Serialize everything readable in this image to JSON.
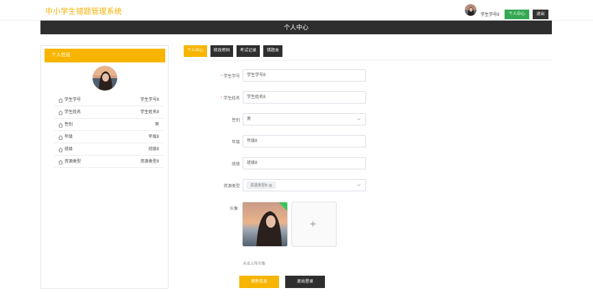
{
  "header": {
    "title": "中小学生错题管理系统",
    "user_label": "学生学号8",
    "center_button": "个人中心",
    "logout_button": "退出"
  },
  "section_title": "个人中心",
  "panel": {
    "title": "个人信息",
    "rows": [
      {
        "label": "学生学号",
        "value": "学生学号8"
      },
      {
        "label": "学生姓名",
        "value": "学生姓名8"
      },
      {
        "label": "性别",
        "value": "男"
      },
      {
        "label": "年级",
        "value": "年级8"
      },
      {
        "label": "班级",
        "value": "班级8"
      },
      {
        "label": "资源类型",
        "value": "资源类型8"
      }
    ]
  },
  "tabs": [
    {
      "label": "个人中心",
      "active": true
    },
    {
      "label": "修改密码",
      "active": false
    },
    {
      "label": "考试记录",
      "active": false
    },
    {
      "label": "错题本",
      "active": false
    }
  ],
  "form": {
    "student_id": {
      "label": "学生学号",
      "value": "学生学号8"
    },
    "student_name": {
      "label": "学生姓名",
      "value": "学生姓名8"
    },
    "gender": {
      "label": "性别",
      "value": "男"
    },
    "grade": {
      "label": "年级",
      "value": "年级8"
    },
    "class_name": {
      "label": "班级",
      "value": "班级8"
    },
    "resource_type": {
      "label": "资源类型",
      "tag": "资源类型8",
      "tag_close": "×"
    },
    "avatar": {
      "label": "头像",
      "upload_plus": "+",
      "hint": "点击上传头像"
    }
  },
  "actions": {
    "update": "更新信息",
    "logout": "退出登录"
  },
  "colors": {
    "accent": "#f7b500",
    "dark": "#2e2e2e",
    "green": "#34a853",
    "required": "#f56c6c"
  }
}
